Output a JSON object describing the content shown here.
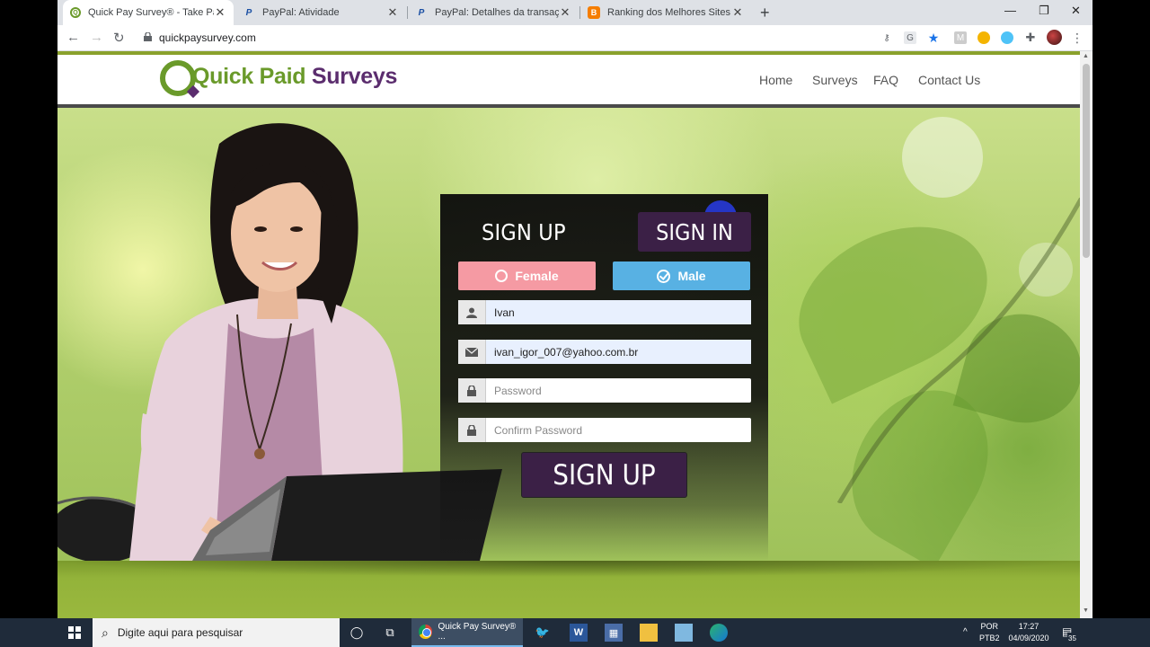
{
  "browser": {
    "tabs": [
      {
        "title": "Quick Pay Survey® - Take Paid Surveys",
        "icon": "quickpay-favicon"
      },
      {
        "title": "PayPal: Atividade",
        "icon": "paypal-favicon"
      },
      {
        "title": "PayPal: Detalhes da transação",
        "icon": "paypal-favicon"
      },
      {
        "title": "Ranking dos Melhores Sites de P",
        "icon": "blogger-favicon"
      }
    ],
    "url": "quickpaysurvey.com"
  },
  "site": {
    "logo_part1": "Quick Paid",
    "logo_part2": "Surveys",
    "nav": [
      "Home",
      "Surveys",
      "FAQ",
      "Contact Us"
    ]
  },
  "form": {
    "tab_signup": "SIGN UP",
    "tab_signin": "SIGN IN",
    "female_label": "Female",
    "male_label": "Male",
    "name_value": "Ivan",
    "email_value": "ivan_igor_007@yahoo.com.br",
    "password_placeholder": "Password",
    "confirm_placeholder": "Confirm Password",
    "submit_label": "SIGN UP",
    "selected_gender": "Male"
  },
  "taskbar": {
    "search_placeholder": "Digite aqui para pesquisar",
    "active_app": "Quick Pay Survey® ...",
    "lang_top": "POR",
    "lang_bottom": "PTB2",
    "time": "17:27",
    "date": "04/09/2020",
    "notifications": "35"
  },
  "colors": {
    "brand_green": "#6a9a2a",
    "brand_purple": "#5b2d6e",
    "female": "#f59aa3",
    "male": "#58b1e3",
    "button": "#3b2046"
  }
}
